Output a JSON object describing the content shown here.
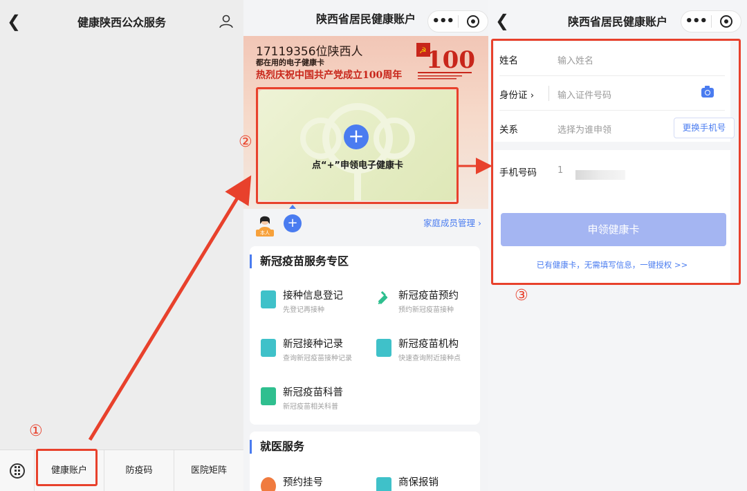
{
  "panel1": {
    "title": "健康陕西公众服务",
    "back_icon": "back-chevron-icon",
    "user_icon": "user-icon",
    "tabs": [
      "健康账户",
      "防疫码",
      "医院矩阵"
    ],
    "step": "①"
  },
  "panel2": {
    "title": "陕西省居民健康账户",
    "banner": {
      "count": "17119356位陕西人",
      "sub": "都在用的电子健康卡",
      "celebrate": "热烈庆祝中国共产党成立100周年",
      "logo_text": "100"
    },
    "card_cta": "点“+”申领电子健康卡",
    "step": "②",
    "avatar_badge": "本人",
    "family_link": "家庭成员管理 ›",
    "sections": [
      {
        "title": "新冠疫苗服务专区",
        "items": [
          {
            "name": "接种信息登记",
            "desc": "先登记再接种"
          },
          {
            "name": "新冠疫苗预约",
            "desc": "预约新冠疫苗接种"
          },
          {
            "name": "新冠接种记录",
            "desc": "查询新冠疫苗接种记录"
          },
          {
            "name": "新冠疫苗机构",
            "desc": "快速查询附近接种点"
          },
          {
            "name": "新冠疫苗科普",
            "desc": "新冠疫苗相关科普"
          }
        ]
      },
      {
        "title": "就医服务",
        "items": [
          {
            "name": "预约挂号",
            "desc": ""
          },
          {
            "name": "商保报销",
            "desc": ""
          }
        ]
      }
    ]
  },
  "panel3": {
    "title": "陕西省居民健康账户",
    "fields": {
      "name": {
        "label": "姓名",
        "placeholder": "输入姓名"
      },
      "id": {
        "label": "身份证 ›",
        "placeholder": "输入证件号码"
      },
      "relation": {
        "label": "关系",
        "placeholder": "选择为谁申领"
      },
      "phone": {
        "label": "手机号码",
        "value": "1"
      }
    },
    "change_phone": "更换手机号",
    "apply_button": "申领健康卡",
    "authorize_link": "已有健康卡，无需填写信息，一键授权 >>",
    "step": "③"
  },
  "colors": {
    "accent": "#4a7cf0",
    "annotation_red": "#e8412c",
    "button_disabled": "#a4b5f2"
  }
}
